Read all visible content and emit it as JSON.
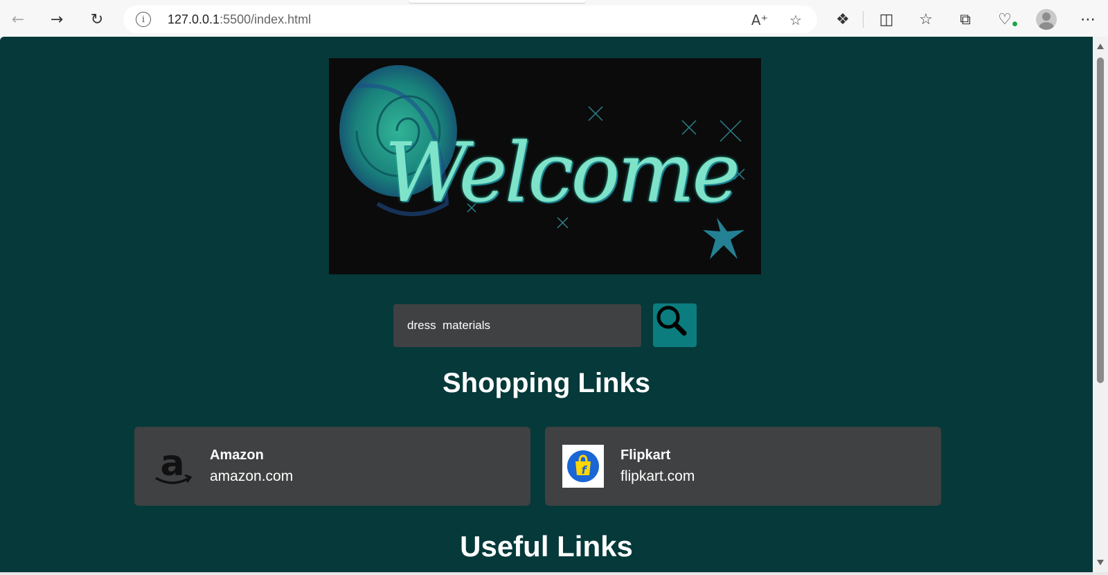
{
  "browser": {
    "url_host": "127.0.0.1",
    "url_rest": ":5500/index.html",
    "icons": [
      "back-icon",
      "forward-icon",
      "refresh-icon",
      "site-info-icon",
      "read-aloud-icon",
      "favorite-star-icon",
      "extensions-icon",
      "split-screen-icon",
      "favorites-icon",
      "collections-icon",
      "browser-essentials-icon",
      "profile-icon",
      "more-icon"
    ]
  },
  "banner": {
    "text": "Welcome"
  },
  "search": {
    "value": "dress  materials",
    "button_icon": "search-icon"
  },
  "sections": {
    "shopping_title": "Shopping Links",
    "useful_title": "Useful Links"
  },
  "shopping_links": [
    {
      "name": "Amazon",
      "site": "amazon.com",
      "icon": "amazon-logo"
    },
    {
      "name": "Flipkart",
      "site": "flipkart.com",
      "icon": "flipkart-logo"
    }
  ],
  "colors": {
    "page_bg": "#06393a",
    "card_bg": "#404142",
    "search_button": "#0b7d7f",
    "banner_text": "#7fe3c9"
  }
}
